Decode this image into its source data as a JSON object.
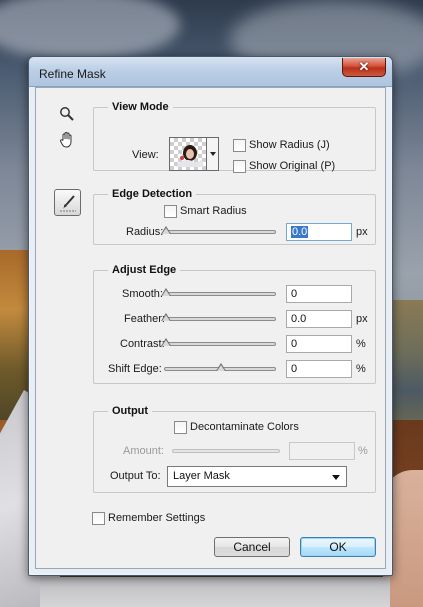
{
  "window": {
    "title": "Refine Mask",
    "close_glyph": "✕"
  },
  "tools": {
    "zoom_icon": "magnifier-icon",
    "hand_icon": "hand-icon",
    "brush_icon": "refine-radius-brush-icon"
  },
  "view_mode": {
    "title": "View Mode",
    "view_label": "View:",
    "show_radius_label": "Show Radius (J)",
    "show_original_label": "Show Original (P)"
  },
  "edge_detection": {
    "title": "Edge Detection",
    "smart_radius_label": "Smart Radius",
    "radius_label": "Radius:",
    "radius_value": "0.0",
    "radius_unit": "px",
    "radius_slider_fraction": 0
  },
  "adjust_edge": {
    "title": "Adjust Edge",
    "smooth_label": "Smooth:",
    "smooth_value": "0",
    "smooth_slider_fraction": 0,
    "feather_label": "Feather:",
    "feather_value": "0.0",
    "feather_unit": "px",
    "feather_slider_fraction": 0,
    "contrast_label": "Contrast:",
    "contrast_value": "0",
    "contrast_unit": "%",
    "contrast_slider_fraction": 0,
    "shift_edge_label": "Shift Edge:",
    "shift_edge_value": "0",
    "shift_edge_unit": "%",
    "shift_edge_slider_fraction": 0.5
  },
  "output": {
    "title": "Output",
    "decontaminate_label": "Decontaminate Colors",
    "amount_label": "Amount:",
    "amount_unit": "%",
    "output_to_label": "Output To:",
    "output_to_value": "Layer Mask"
  },
  "footer": {
    "remember_label": "Remember Settings",
    "cancel_label": "Cancel",
    "ok_label": "OK"
  }
}
